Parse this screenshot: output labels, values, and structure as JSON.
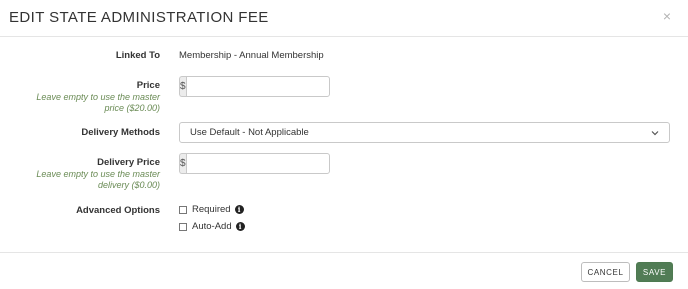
{
  "dialog": {
    "title": "EDIT STATE ADMINISTRATION FEE",
    "close_glyph": "×"
  },
  "form": {
    "linked_to": {
      "label": "Linked To",
      "value": "Membership - Annual Membership"
    },
    "price": {
      "label": "Price",
      "help_line1": "Leave empty to use the master",
      "help_line2": "price ($20.00)",
      "addon": "$",
      "value": "",
      "placeholder": ""
    },
    "delivery_methods": {
      "label": "Delivery Methods",
      "selected": "Use Default - Not Applicable"
    },
    "delivery_price": {
      "label": "Delivery Price",
      "help_line1": "Leave empty to use the master",
      "help_line2": "delivery ($0.00)",
      "addon": "$",
      "value": "",
      "placeholder": ""
    },
    "advanced_options": {
      "label": "Advanced Options",
      "required_label": "Required",
      "required_checked": false,
      "auto_add_label": "Auto-Add",
      "auto_add_checked": false
    }
  },
  "footer": {
    "cancel_label": "CANCEL",
    "save_label": "SAVE"
  },
  "colors": {
    "save_button": "#517c55",
    "help_text": "#6a8b55"
  },
  "icons": {
    "close": "close-icon",
    "select_chevron": "chevron-down-icon",
    "info": "info-icon"
  }
}
